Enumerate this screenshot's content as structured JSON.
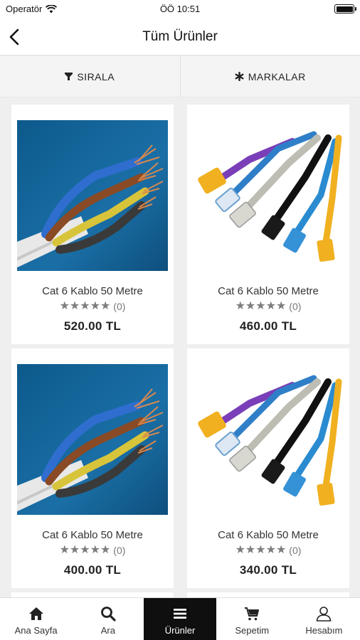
{
  "status_bar": {
    "carrier": "Operatör",
    "time": "ÖÖ 10:51"
  },
  "header": {
    "title": "Tüm Ürünler"
  },
  "filters": {
    "sort_label": "SIRALA",
    "brands_label": "MARKALAR"
  },
  "products": [
    {
      "name": "Cat 6 Kablo 50 Metre",
      "rating": 5,
      "review_count": "(0)",
      "price": "520.00 TL",
      "image": "copper-cable"
    },
    {
      "name": "Cat 6 Kablo 50 Metre",
      "rating": 5,
      "review_count": "(0)",
      "price": "460.00 TL",
      "image": "ethernet-cables"
    },
    {
      "name": "Cat 6 Kablo 50 Metre",
      "rating": 5,
      "review_count": "(0)",
      "price": "400.00 TL",
      "image": "copper-cable"
    },
    {
      "name": "Cat 6 Kablo 50 Metre",
      "rating": 5,
      "review_count": "(0)",
      "price": "340.00 TL",
      "image": "ethernet-cables"
    }
  ],
  "tabbar": {
    "items": [
      {
        "label": "Ana Sayfa",
        "icon": "home-icon"
      },
      {
        "label": "Ara",
        "icon": "search-icon"
      },
      {
        "label": "Ürünler",
        "icon": "menu-icon",
        "active": true
      },
      {
        "label": "Sepetim",
        "icon": "cart-icon"
      },
      {
        "label": "Hesabım",
        "icon": "user-icon"
      }
    ]
  }
}
